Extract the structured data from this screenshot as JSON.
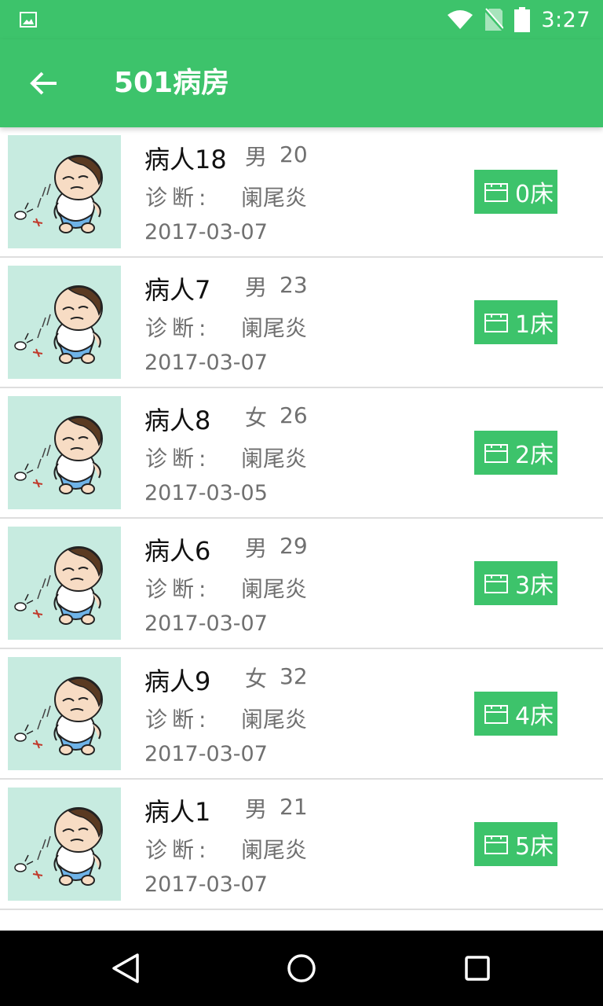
{
  "status_bar": {
    "time": "3:27",
    "icons": [
      "image-notification-icon",
      "wifi-icon",
      "no-sim-icon",
      "battery-icon"
    ]
  },
  "app_bar": {
    "title": "501病房",
    "back_icon": "arrow-left-icon"
  },
  "colors": {
    "primary": "#3dc36b",
    "avatar_bg": "#c7ebe0",
    "divider": "#dedede",
    "text_primary": "#111111",
    "text_secondary": "#707070"
  },
  "patients": [
    {
      "name": "病人18",
      "gender": "男",
      "age": "20",
      "diag_label": "诊断:",
      "diagnosis": "阑尾炎",
      "date": "2017-03-07",
      "bed": "0床"
    },
    {
      "name": "病人7",
      "gender": "男",
      "age": "23",
      "diag_label": "诊断:",
      "diagnosis": "阑尾炎",
      "date": "2017-03-07",
      "bed": "1床"
    },
    {
      "name": "病人8",
      "gender": "女",
      "age": "26",
      "diag_label": "诊断:",
      "diagnosis": "阑尾炎",
      "date": "2017-03-05",
      "bed": "2床"
    },
    {
      "name": "病人6",
      "gender": "男",
      "age": "29",
      "diag_label": "诊断:",
      "diagnosis": "阑尾炎",
      "date": "2017-03-07",
      "bed": "3床"
    },
    {
      "name": "病人9",
      "gender": "女",
      "age": "32",
      "diag_label": "诊断:",
      "diagnosis": "阑尾炎",
      "date": "2017-03-07",
      "bed": "4床"
    },
    {
      "name": "病人1",
      "gender": "男",
      "age": "21",
      "diag_label": "诊断:",
      "diagnosis": "阑尾炎",
      "date": "2017-03-07",
      "bed": "5床"
    }
  ],
  "nav_bar": {
    "buttons": [
      "back-triangle-icon",
      "home-circle-icon",
      "recents-square-icon"
    ]
  }
}
